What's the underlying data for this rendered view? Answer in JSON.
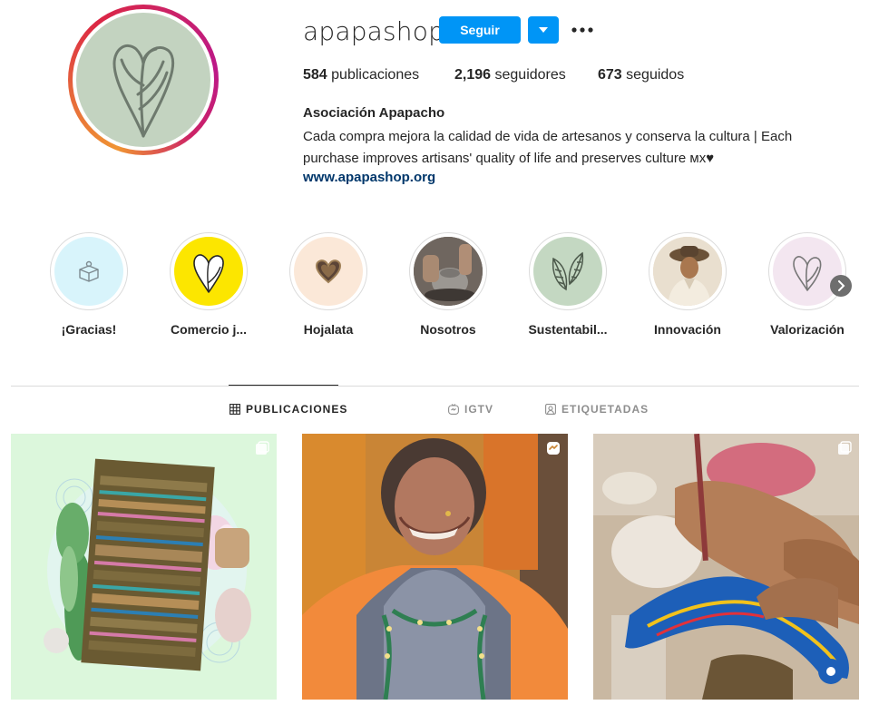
{
  "profile": {
    "username": "apapashop",
    "follow_label": "Seguir",
    "posts_count": "584",
    "posts_label": "publicaciones",
    "followers_count": "2,196",
    "followers_label": "seguidores",
    "following_count": "673",
    "following_label": "seguidos",
    "full_name": "Asociación Apapacho",
    "bio": "Cada compra mejora la calidad de vida de artesanos y conserva la cultura | Each purchase improves artisans' quality of life and preserves culture ᴍx♥",
    "website": "www.apapashop.org"
  },
  "highlights": [
    {
      "label": "¡Gracias!",
      "icon": "gift-box-icon"
    },
    {
      "label": "Comercio j...",
      "icon": "heart-logo-icon"
    },
    {
      "label": "Hojalata",
      "icon": "tin-heart-icon"
    },
    {
      "label": "Nosotros",
      "icon": "pottery-photo"
    },
    {
      "label": "Sustentabil...",
      "icon": "leaves-icon"
    },
    {
      "label": "Innovación",
      "icon": "artisan-hat-photo"
    },
    {
      "label": "Valorización",
      "icon": "heart-logo-icon"
    }
  ],
  "tabs": [
    {
      "label": "PUBLICACIONES",
      "icon": "grid-icon",
      "active": true
    },
    {
      "label": "IGTV",
      "icon": "igtv-icon",
      "active": false
    },
    {
      "label": "ETIQUETADAS",
      "icon": "tagged-icon",
      "active": false
    }
  ],
  "posts": [
    {
      "subject": "woven textile rug with cactus illustration",
      "badge": "carousel-icon"
    },
    {
      "subject": "smiling artisan woman in embroidered apron",
      "badge": "reels-icon"
    },
    {
      "subject": "hand painting an alebrije figure",
      "badge": "carousel-icon"
    }
  ],
  "colors": {
    "accent": "#0095f6",
    "link": "#00376b",
    "text": "#262626",
    "muted": "#8e8e8e",
    "avatar_bg": "#c3d3c0"
  }
}
